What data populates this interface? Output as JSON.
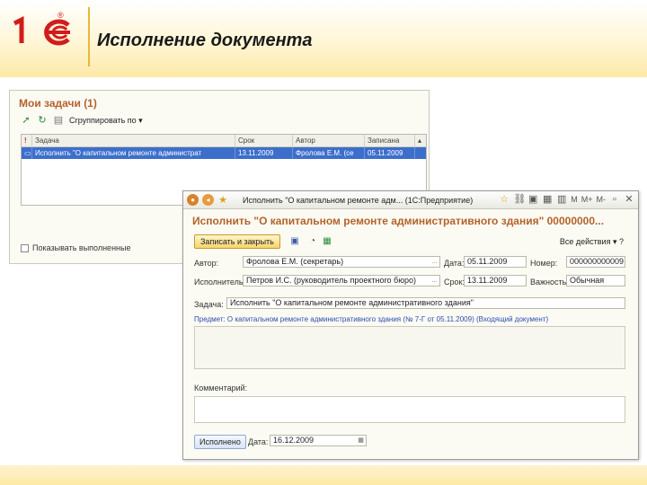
{
  "header": {
    "title": "Исполнение документа",
    "logo_text": "1С",
    "logo_reg": "®"
  },
  "colors": {
    "accent": "#b5622b",
    "logo": "#d21c1c",
    "selection": "#3c6ecc"
  },
  "tasks_window": {
    "title": "Мои задачи (1)",
    "toolbar": {
      "group_label": "Сгруппировать по"
    },
    "columns": [
      "!",
      "Задача",
      "Срок",
      "Автор",
      "Записана"
    ],
    "row": {
      "task": "Исполнить \"О капитальном ремонте администрат",
      "term": "13.11.2009",
      "author": "Фролова Е.М. (се",
      "created": "05.11.2009"
    },
    "checkbox_label": "Показывать выполненные"
  },
  "doc_window": {
    "window_title": "Исполнить \"О капитальном ремонте адм... (1С:Предприятие)",
    "titlebar_right": [
      "M",
      "M+",
      "M-"
    ],
    "heading": "Исполнить \"О капитальном ремонте административного здания\" 00000000...",
    "save_close_label": "Записать и закрыть",
    "all_actions_label": "Все действия",
    "fields": {
      "author_label": "Автор:",
      "author_value": "Фролова Е.М. (секретарь)",
      "date_label": "Дата:",
      "date_value": "05.11.2009",
      "number_label": "Номер:",
      "number_value": "000000000009",
      "executor_label": "Исполнитель:",
      "executor_value": "Петров И.С. (руководитель проектного бюро)",
      "term_label": "Срок:",
      "term_value": "13.11.2009",
      "importance_label": "Важность:",
      "importance_value": "Обычная",
      "task_label": "Задача:",
      "task_value": "Исполнить \"О капитальном ремонте административного здания\"",
      "subject_text": "Предмет: О капитальном ремонте административного здания (№ 7-Г от 05.11.2009) (Входящий документ)",
      "comment_label": "Комментарий:"
    },
    "done_button_label": "Исполнено",
    "done_date_label": "Дата:",
    "done_date_value": "16.12.2009"
  }
}
